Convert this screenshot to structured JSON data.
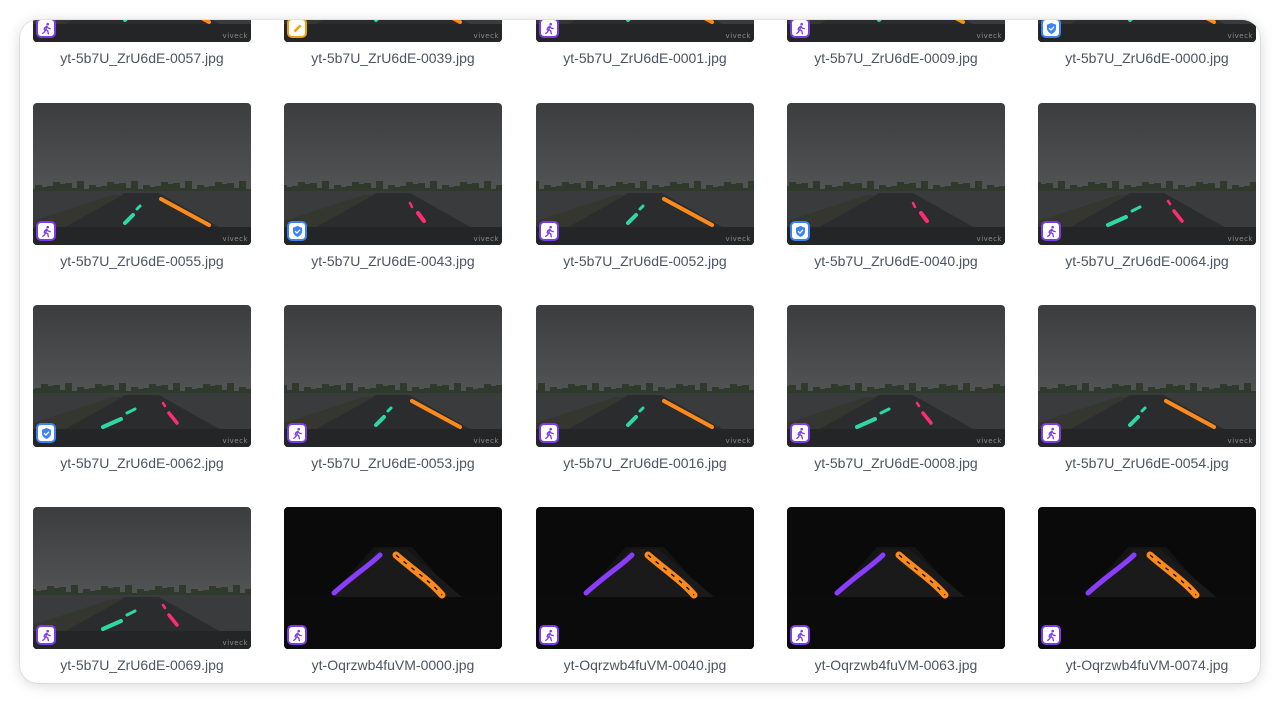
{
  "colors": {
    "badge_pedestrian": "#7c3aed",
    "badge_verified": "#3b82f6",
    "badge_edit": "#f59e0b",
    "lane_green": "#2ed8a5",
    "lane_red": "#ff2d6f",
    "lane_orange": "#ff8a1c",
    "lane_purple": "#8b3dff"
  },
  "watermark": "viveck",
  "gallery": {
    "items": [
      {
        "filename": "yt-5b7U_ZrU6dE-0057.jpg",
        "badge": "pedestrian-icon",
        "scene": "day",
        "lanes": "go"
      },
      {
        "filename": "yt-5b7U_ZrU6dE-0039.jpg",
        "badge": "pencil-icon",
        "scene": "day",
        "lanes": "go"
      },
      {
        "filename": "yt-5b7U_ZrU6dE-0001.jpg",
        "badge": "pedestrian-icon",
        "scene": "day",
        "lanes": "go"
      },
      {
        "filename": "yt-5b7U_ZrU6dE-0009.jpg",
        "badge": "pedestrian-icon",
        "scene": "day",
        "lanes": "go"
      },
      {
        "filename": "yt-5b7U_ZrU6dE-0000.jpg",
        "badge": "shield-check-icon",
        "scene": "day",
        "lanes": "go"
      },
      {
        "filename": "yt-5b7U_ZrU6dE-0055.jpg",
        "badge": "pedestrian-icon",
        "scene": "day",
        "lanes": "go"
      },
      {
        "filename": "yt-5b7U_ZrU6dE-0043.jpg",
        "badge": "shield-check-icon",
        "scene": "day",
        "lanes": "r"
      },
      {
        "filename": "yt-5b7U_ZrU6dE-0052.jpg",
        "badge": "pedestrian-icon",
        "scene": "day",
        "lanes": "go"
      },
      {
        "filename": "yt-5b7U_ZrU6dE-0040.jpg",
        "badge": "shield-check-icon",
        "scene": "day",
        "lanes": "r"
      },
      {
        "filename": "yt-5b7U_ZrU6dE-0064.jpg",
        "badge": "pedestrian-icon",
        "scene": "day",
        "lanes": "gr"
      },
      {
        "filename": "yt-5b7U_ZrU6dE-0062.jpg",
        "badge": "shield-check-icon",
        "scene": "day",
        "lanes": "gr"
      },
      {
        "filename": "yt-5b7U_ZrU6dE-0053.jpg",
        "badge": "pedestrian-icon",
        "scene": "day",
        "lanes": "go"
      },
      {
        "filename": "yt-5b7U_ZrU6dE-0016.jpg",
        "badge": "pedestrian-icon",
        "scene": "day",
        "lanes": "go"
      },
      {
        "filename": "yt-5b7U_ZrU6dE-0008.jpg",
        "badge": "pedestrian-icon",
        "scene": "day",
        "lanes": "gr"
      },
      {
        "filename": "yt-5b7U_ZrU6dE-0054.jpg",
        "badge": "pedestrian-icon",
        "scene": "day",
        "lanes": "go"
      },
      {
        "filename": "yt-5b7U_ZrU6dE-0069.jpg",
        "badge": "pedestrian-icon",
        "scene": "day",
        "lanes": "gr"
      },
      {
        "filename": "yt-Oqrzwb4fuVM-0000.jpg",
        "badge": "pedestrian-icon",
        "scene": "night",
        "lanes": "po"
      },
      {
        "filename": "yt-Oqrzwb4fuVM-0040.jpg",
        "badge": "pedestrian-icon",
        "scene": "night",
        "lanes": "po"
      },
      {
        "filename": "yt-Oqrzwb4fuVM-0063.jpg",
        "badge": "pedestrian-icon",
        "scene": "night",
        "lanes": "po"
      },
      {
        "filename": "yt-Oqrzwb4fuVM-0074.jpg",
        "badge": "pedestrian-icon",
        "scene": "night",
        "lanes": "po"
      }
    ]
  }
}
